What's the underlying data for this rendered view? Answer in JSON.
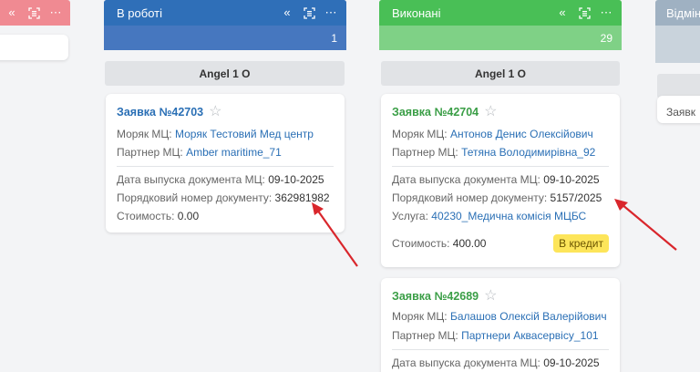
{
  "columns": [
    {
      "title": "",
      "count": "",
      "header_color": "#f08a92",
      "count_color": ""
    },
    {
      "title": "В роботі",
      "count": "1",
      "header_color": "#2f6fb8",
      "count_color": "#4677bf"
    },
    {
      "title": "Виконані",
      "count": "29",
      "header_color": "#49bf56",
      "count_color": "#7fd186"
    },
    {
      "title": "Відмін",
      "count": "",
      "header_color": "#9fb1c2",
      "count_color": "#c9d3dc"
    }
  ],
  "header_icons": [
    "collapse-icon",
    "select-icon",
    "more-icon"
  ],
  "groups": {
    "col2": "Angel 1 O",
    "col3": "Angel 1 O"
  },
  "cards": {
    "c42703": {
      "title": "Заявка №42703",
      "seaman_label": "Моряк МЦ:",
      "seaman": "Моряк Тестовий Мед центр",
      "partner_label": "Партнер МЦ:",
      "partner": "Amber maritime_71",
      "date_label": "Дата выпуска документа МЦ:",
      "date": "09-10-2025",
      "docnum_label": "Порядковий номер документу:",
      "docnum": "362981982",
      "cost_label": "Стоимость:",
      "cost": "0.00"
    },
    "c42704": {
      "title": "Заявка №42704",
      "seaman_label": "Моряк МЦ:",
      "seaman": "Антонов Денис Олексійович",
      "partner_label": "Партнер МЦ:",
      "partner": "Тетяна Володимирівна_92",
      "date_label": "Дата выпуска документа МЦ:",
      "date": "09-10-2025",
      "docnum_label": "Порядковий номер документу:",
      "docnum": "5157/2025",
      "service_label": "Услуга:",
      "service": "40230_Медична комісія МЦБС",
      "cost_label": "Стоимость:",
      "cost": "400.00",
      "badge": "В кредит"
    },
    "c42689": {
      "title": "Заявка №42689",
      "seaman_label": "Моряк МЦ:",
      "seaman": "Балашов Олексій Валерійович",
      "partner_label": "Партнер МЦ:",
      "partner": "Партнери Аквасервісу_101",
      "date_label": "Дата выпуска документа МЦ:",
      "date": "09-10-2025"
    },
    "partial": {
      "title": "Заявк"
    }
  },
  "colors": {
    "title_blue": "#2a6fb5",
    "title_green": "#3a9e46",
    "link": "#2a6fb5",
    "arrow": "#d9262c"
  }
}
